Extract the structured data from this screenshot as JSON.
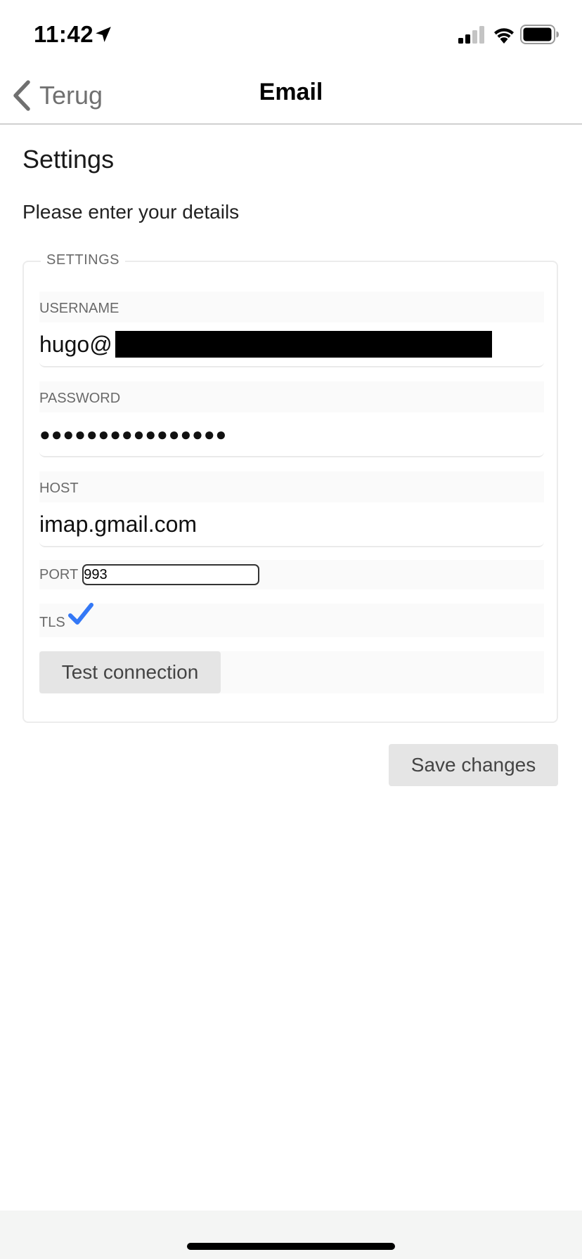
{
  "status_bar": {
    "time": "11:42",
    "icons": [
      "location-arrow-icon",
      "cellular-signal-icon",
      "wifi-icon",
      "battery-icon"
    ]
  },
  "nav": {
    "back_label": "Terug",
    "title": "Email"
  },
  "page": {
    "heading": "Settings",
    "subtitle": "Please enter your details"
  },
  "form": {
    "legend": "SETTINGS",
    "username": {
      "label": "USERNAME",
      "value": "hugo@"
    },
    "password": {
      "label": "PASSWORD",
      "value": "●●●●●●●●●●●●●●●●"
    },
    "host": {
      "label": "HOST",
      "value": "imap.gmail.com"
    },
    "port": {
      "label": "PORT",
      "value": "993"
    },
    "tls": {
      "label": "TLS",
      "checked": true
    },
    "test_button": "Test connection"
  },
  "actions": {
    "save_button": "Save changes"
  },
  "colors": {
    "accent": "#3478f6",
    "button_bg": "#e5e5e5",
    "label_gray": "#6a6a6a"
  }
}
